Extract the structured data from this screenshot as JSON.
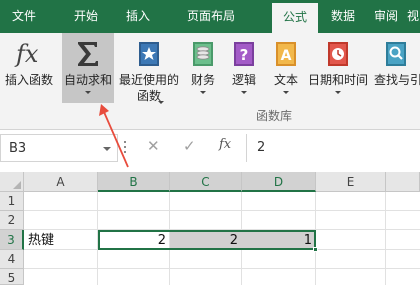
{
  "menu": {
    "tabs": [
      {
        "label": "文件"
      },
      {
        "label": "开始"
      },
      {
        "label": "插入"
      },
      {
        "label": "页面布局"
      },
      {
        "label": "公式",
        "active": true
      },
      {
        "label": "数据"
      },
      {
        "label": "审阅"
      },
      {
        "label": "视"
      }
    ]
  },
  "ribbon": {
    "insert_function": {
      "label": "插入函数"
    },
    "autosum": {
      "label": "自动求和"
    },
    "recent": {
      "label1": "最近使用的",
      "label2": "函数"
    },
    "financial": {
      "label": "财务"
    },
    "logical": {
      "label": "逻辑"
    },
    "text": {
      "label": "文本"
    },
    "datetime": {
      "label": "日期和时间"
    },
    "lookup": {
      "label": "查找与引"
    },
    "group_label": "函数库"
  },
  "formula_bar": {
    "name_box": "B3",
    "formula": "2"
  },
  "grid": {
    "columns": [
      "A",
      "B",
      "C",
      "D",
      "E"
    ],
    "rows": [
      "1",
      "2",
      "3",
      "4",
      "5"
    ],
    "cells": {
      "A3": "热键",
      "B3": "2",
      "C3": "2",
      "D3": "1"
    },
    "selected_range": "B3:D3"
  },
  "colors": {
    "brand": "#217346",
    "annotation_arrow": "#e84c3d"
  }
}
